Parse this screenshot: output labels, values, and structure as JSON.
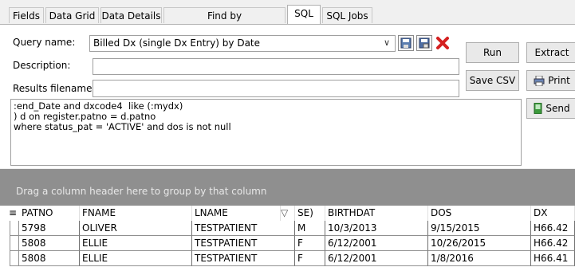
{
  "tabs": [
    {
      "label": "Fields"
    },
    {
      "label": "Data Grid"
    },
    {
      "label": "Data Details"
    },
    {
      "label": "Find by Name/Description"
    },
    {
      "label": "SQL"
    },
    {
      "label": "SQL Jobs"
    }
  ],
  "form": {
    "query_name_label": "Query name:",
    "query_name_value": "Billed Dx (single Dx Entry) by Date",
    "description_label": "Description:",
    "description_value": "",
    "results_filename_label": "Results filename:",
    "results_filename_value": ""
  },
  "buttons": {
    "run": "Run",
    "extract": "Extract",
    "save_csv": "Save CSV",
    "print": "Print",
    "send": "Send"
  },
  "sql_lines": [
    ":end_Date and dxcode4  like (:mydx)",
    ") d on register.patno = d.patno",
    "where status_pat = 'ACTIVE' and dos is not null"
  ],
  "grid": {
    "group_hint": "Drag a column header here to group by that column",
    "columns": [
      "PATNO",
      "FNAME",
      "LNAME",
      "SE)",
      "BIRTHDAT",
      "DOS",
      "DX"
    ],
    "rows": [
      [
        "5798",
        "OLIVER",
        "TESTPATIENT",
        "M",
        "10/3/2013",
        "9/15/2015",
        "H66.42"
      ],
      [
        "5808",
        "ELLIE",
        "TESTPATIENT",
        "F",
        "6/12/2001",
        "10/26/2015",
        "H66.42"
      ],
      [
        "5808",
        "ELLIE",
        "TESTPATIENT",
        "F",
        "6/12/2001",
        "1/8/2016",
        "H66.41"
      ]
    ]
  },
  "colors": {
    "group_band": "#8f8f8f",
    "delete_icon": "#d42020"
  }
}
